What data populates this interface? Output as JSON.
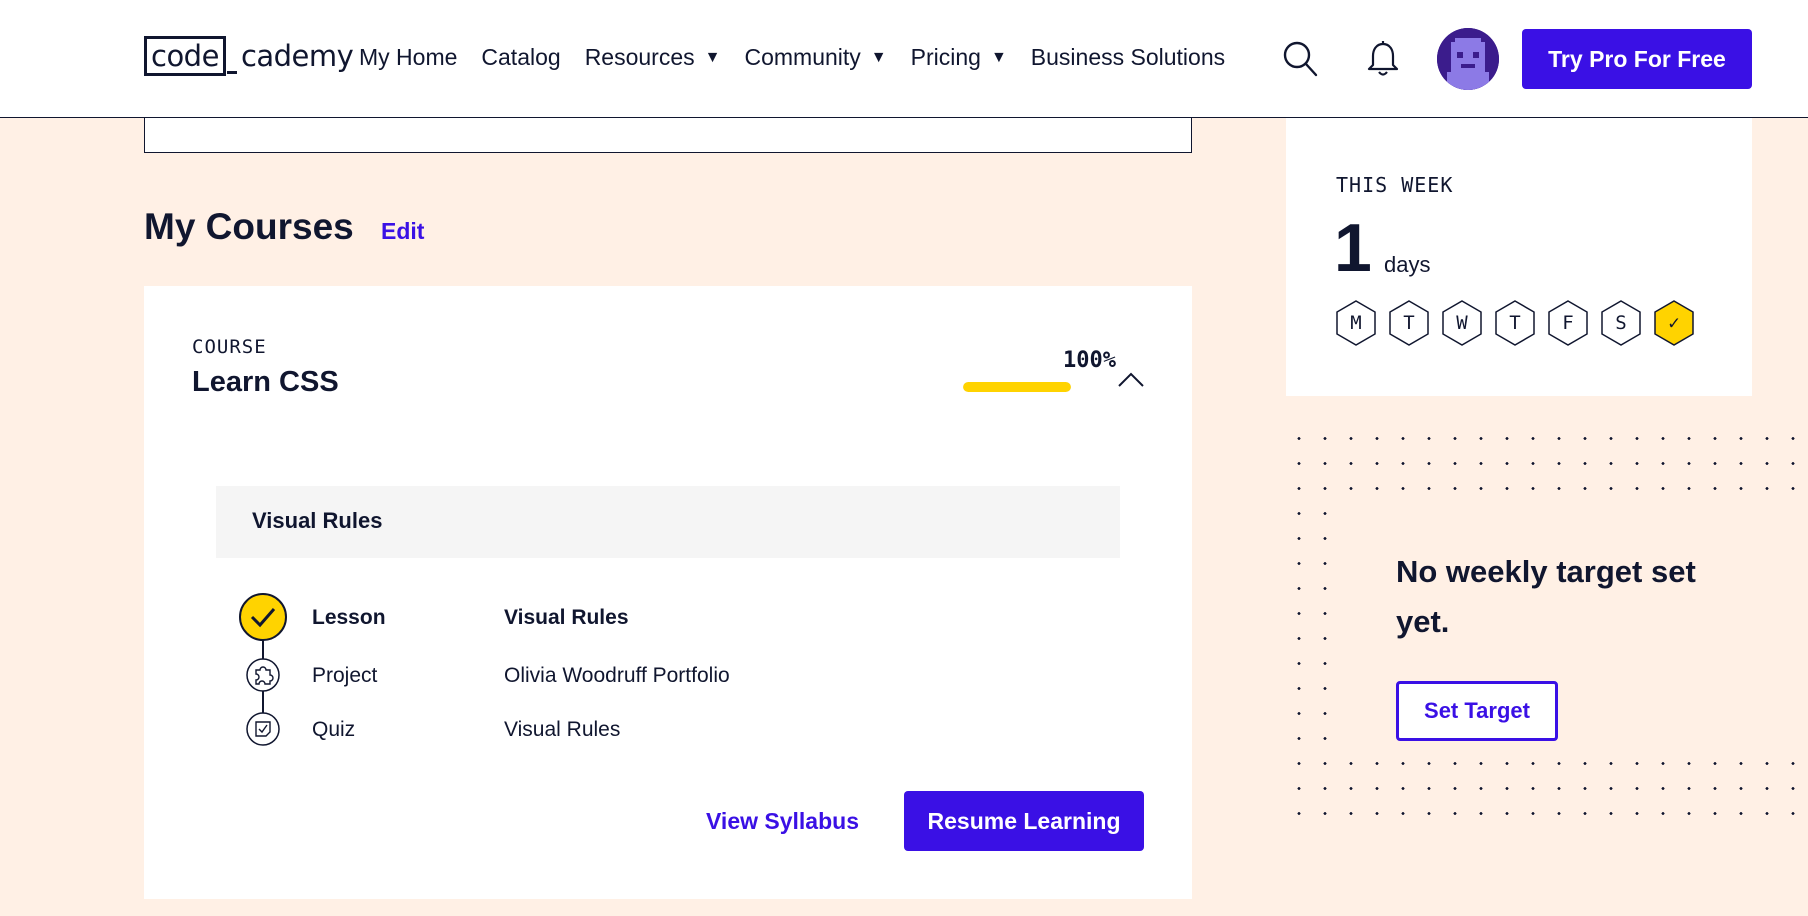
{
  "header": {
    "logo_left": "code",
    "logo_right": "cademy",
    "nav": [
      {
        "label": "My Home",
        "has_dropdown": false
      },
      {
        "label": "Catalog",
        "has_dropdown": false
      },
      {
        "label": "Resources",
        "has_dropdown": true
      },
      {
        "label": "Community",
        "has_dropdown": true
      },
      {
        "label": "Pricing",
        "has_dropdown": true
      },
      {
        "label": "Business Solutions",
        "has_dropdown": false
      }
    ],
    "dropdown_glyph": "▼",
    "cta_label": "Try Pro For Free"
  },
  "courses_section": {
    "title": "My Courses",
    "edit_label": "Edit"
  },
  "course": {
    "kicker": "COURSE",
    "title": "Learn CSS",
    "progress_label": "100%",
    "progress_fraction": 1.0,
    "module_title": "Visual Rules",
    "items": [
      {
        "type": "Lesson",
        "name": "Visual Rules",
        "icon": "check-icon",
        "completed": true
      },
      {
        "type": "Project",
        "name": "Olivia Woodruff Portfolio",
        "icon": "puzzle-icon",
        "completed": false
      },
      {
        "type": "Quiz",
        "name": "Visual Rules",
        "icon": "quiz-icon",
        "completed": false
      }
    ],
    "view_syllabus_label": "View Syllabus",
    "resume_label": "Resume Learning"
  },
  "week": {
    "label": "THIS WEEK",
    "count": "1",
    "unit": "days",
    "days": [
      "M",
      "T",
      "W",
      "T",
      "F",
      "S",
      "✓"
    ],
    "active_day_index": 6
  },
  "target": {
    "title": "No weekly target set yet.",
    "button_label": "Set Target"
  },
  "colors": {
    "brand": "#3a10e5",
    "accent_yellow": "#ffd300",
    "navy": "#10162f",
    "page_bg": "#fff0e5"
  }
}
